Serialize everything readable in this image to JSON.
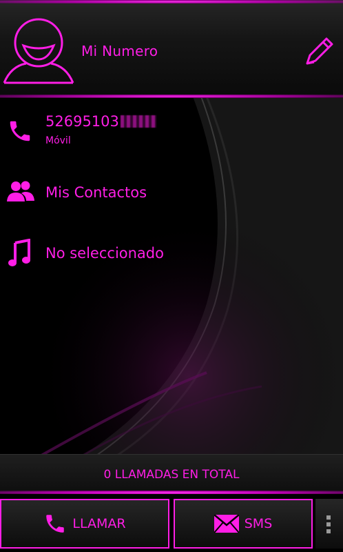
{
  "header": {
    "title": "Mi Numero",
    "avatar_icon": "person-avatar-icon",
    "edit_icon": "pencil-edit-icon"
  },
  "rows": {
    "phone": {
      "number": "52695103",
      "type": "Móvil",
      "icon": "phone-icon"
    },
    "contacts": {
      "label": "Mis Contactos",
      "icon": "contacts-icon"
    },
    "ringtone": {
      "label": "No seleccionado",
      "icon": "music-note-icon"
    }
  },
  "total": {
    "label": "0 LLAMADAS EN TOTAL"
  },
  "buttons": {
    "call_label": "LLAMAR",
    "sms_label": "SMS"
  },
  "colors": {
    "accent": "#ff1ee6",
    "background": "#000000"
  }
}
